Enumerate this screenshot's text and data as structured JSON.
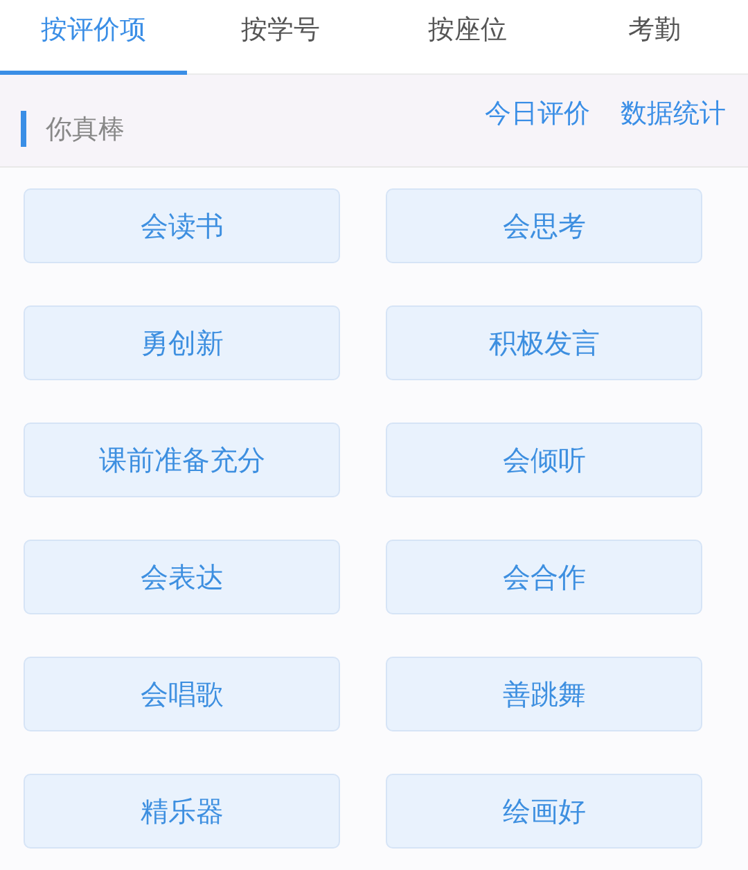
{
  "tabs": [
    {
      "label": "按评价项",
      "selected": true
    },
    {
      "label": "按学号",
      "selected": false
    },
    {
      "label": "按座位",
      "selected": false
    },
    {
      "label": "考勤",
      "selected": false
    }
  ],
  "section": {
    "title": "你真棒",
    "links": [
      "今日评价",
      "数据统计"
    ]
  },
  "items": [
    "会读书",
    "会思考",
    "勇创新",
    "积极发言",
    "课前准备充分",
    "会倾听",
    "会表达",
    "会合作",
    "会唱歌",
    "善跳舞",
    "精乐器",
    "绘画好"
  ]
}
